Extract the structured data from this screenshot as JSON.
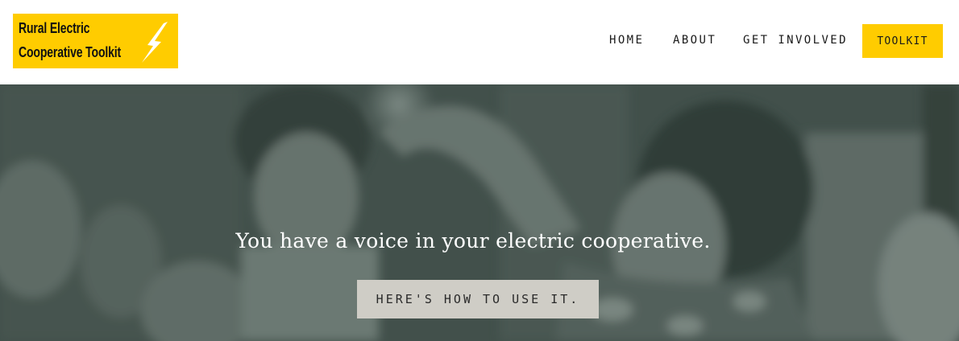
{
  "logo": {
    "line1": "Rural Electric",
    "line2": "Cooperative Toolkit",
    "icon": "lightning-bolt-icon",
    "background": "#ffcc00"
  },
  "nav": {
    "home": "HOME",
    "about": "ABOUT",
    "get_involved": "GET INVOLVED",
    "toolkit": "TOOLKIT"
  },
  "hero": {
    "headline": "You have a voice in your electric cooperative.",
    "button_label": "HERE'S HOW TO USE IT."
  },
  "colors": {
    "accent": "#ffcc00",
    "hero_overlay": "#3e4d47",
    "button_bg": "#cfcdc6"
  }
}
